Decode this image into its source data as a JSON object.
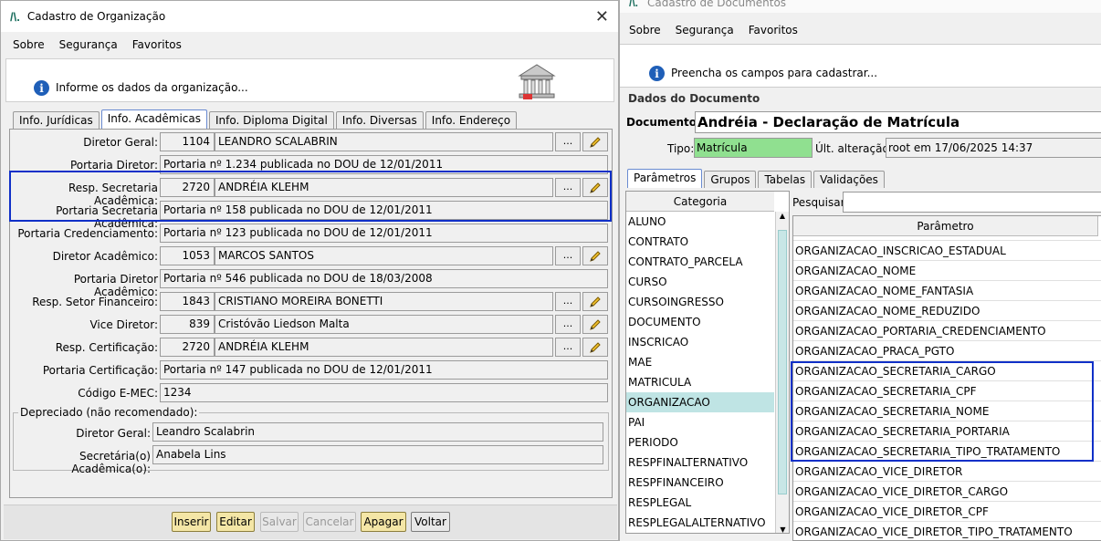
{
  "left_window": {
    "title": "Cadastro de Organização",
    "close_glyph": "✕",
    "menu": [
      "Sobre",
      "Segurança",
      "Favoritos"
    ],
    "info_text": "Informe os dados da organização...",
    "tabs": [
      "Info. Jurídicas",
      "Info. Acadêmicas",
      "Info. Diploma Digital",
      "Info. Diversas",
      "Info. Endereço"
    ],
    "active_tab": "Info. Acadêmicas",
    "rows": [
      {
        "label": "Diretor Geral:",
        "code": "1104",
        "value": "LEANDRO SCALABRIN",
        "has_buttons": true
      },
      {
        "label": "Portaria Diretor:",
        "value": "Portaria nº 1.234 publicada no DOU de 12/01/2011",
        "has_buttons": false
      },
      {
        "label": "Resp. Secretaria Acadêmica:",
        "code": "2720",
        "value": "ANDRÉIA KLEHM",
        "has_buttons": true
      },
      {
        "label": "Portaria Secretaria Acadêmica:",
        "value": "Portaria nº 158 publicada no DOU de 12/01/2011",
        "has_buttons": false
      },
      {
        "label": "Portaria Credenciamento:",
        "value": "Portaria nº 123 publicada no DOU de 12/01/2011",
        "has_buttons": false
      },
      {
        "label": "Diretor Acadêmico:",
        "code": "1053",
        "value": "MARCOS SANTOS",
        "has_buttons": true
      },
      {
        "label": "Portaria Diretor Acadêmico:",
        "value": "Portaria nº 546 publicada no DOU de 18/03/2008",
        "has_buttons": false
      },
      {
        "label": "Resp. Setor Financeiro:",
        "code": "1843",
        "value": "CRISTIANO MOREIRA BONETTI",
        "has_buttons": true
      },
      {
        "label": "Vice Diretor:",
        "code": "839",
        "value": "Cristóvão Liedson Malta",
        "has_buttons": true
      },
      {
        "label": "Resp. Certificação:",
        "code": "2720",
        "value": "ANDRÉIA KLEHM",
        "has_buttons": true
      },
      {
        "label": "Portaria Certificação:",
        "value": "Portaria nº 147 publicada no DOU de 12/01/2011",
        "has_buttons": false
      },
      {
        "label": "Código E-MEC:",
        "value": "1234",
        "has_buttons": false
      }
    ],
    "dots_label": "...",
    "deprecated": {
      "title": "Depreciado (não recomendado):",
      "rows": [
        {
          "label": "Diretor Geral:",
          "value": "Leandro Scalabrin"
        },
        {
          "label": "Secretária(o) Acadêmica(o):",
          "value": "Anabela Lins"
        }
      ]
    },
    "buttons": {
      "insert": "Inserir",
      "edit": "Editar",
      "save": "Salvar",
      "cancel": "Cancelar",
      "delete": "Apagar",
      "back": "Voltar"
    }
  },
  "right_window": {
    "title": "Cadastro de Documentos",
    "menu": [
      "Sobre",
      "Segurança",
      "Favoritos"
    ],
    "info_text": "Preencha os campos para cadastrar...",
    "section_title": "Dados do Documento",
    "document_label": "Documento:",
    "document_value": "Andréia - Declaração de Matrícula",
    "type_label": "Tipo:",
    "type_value": "Matrícula",
    "last_change_label": "Últ. alteração:",
    "last_change_value": "root em 17/06/2025 14:37",
    "tabs": [
      "Parâmetros",
      "Grupos",
      "Tabelas",
      "Validações"
    ],
    "category_header": "Categoria",
    "categories": [
      "ALUNO",
      "CONTRATO",
      "CONTRATO_PARCELA",
      "CURSO",
      "CURSOINGRESSO",
      "DOCUMENTO",
      "INSCRICAO",
      "MAE",
      "MATRICULA",
      "ORGANIZACAO",
      "PAI",
      "PERIODO",
      "RESPFINALTERNATIVO",
      "RESPFINANCEIRO",
      "RESPLEGAL",
      "RESPLEGALALTERNATIVO"
    ],
    "selected_category": "ORGANIZACAO",
    "search_label": "Pesquisar:",
    "search_value": "",
    "param_header": "Parâmetro",
    "params": [
      "ORGANIZACAO_INSCRICAO_ESTADUAL",
      "ORGANIZACAO_NOME",
      "ORGANIZACAO_NOME_FANTASIA",
      "ORGANIZACAO_NOME_REDUZIDO",
      "ORGANIZACAO_PORTARIA_CREDENCIAMENTO",
      "ORGANIZACAO_PRACA_PGTO",
      "ORGANIZACAO_SECRETARIA_CARGO",
      "ORGANIZACAO_SECRETARIA_CPF",
      "ORGANIZACAO_SECRETARIA_NOME",
      "ORGANIZACAO_SECRETARIA_PORTARIA",
      "ORGANIZACAO_SECRETARIA_TIPO_TRATAMENTO",
      "ORGANIZACAO_VICE_DIRETOR",
      "ORGANIZACAO_VICE_DIRETOR_CARGO",
      "ORGANIZACAO_VICE_DIRETOR_CPF",
      "ORGANIZACAO_VICE_DIRETOR_TIPO_TRATAMENTO"
    ]
  },
  "colors": {
    "highlight": "#1030c8",
    "type_field": "#90e090",
    "selected_row": "#bfe4e4"
  }
}
